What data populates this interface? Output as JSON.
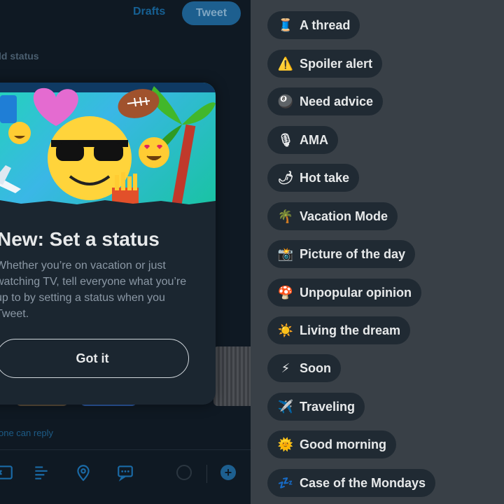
{
  "composer": {
    "drafts_label": "Drafts",
    "tweet_button_label": "Tweet",
    "add_status_label": "ld status",
    "reply_setting_label": "one can reply"
  },
  "toolbar": {
    "icons": [
      "gif-icon",
      "poll-icon",
      "location-icon",
      "chat-icon"
    ],
    "add_button_label": "+"
  },
  "popup": {
    "title": "New: Set a status",
    "body": "Whether you’re on vacation or just watching TV, tell everyone what you’re up to by setting a status when you Tweet.",
    "button_label": "Got it",
    "art_icons": [
      "sunglasses-emoji-icon",
      "heart-icon",
      "airplane-icon",
      "football-icon",
      "palm-tree-icon",
      "heart-eyes-emoji-icon",
      "fries-icon",
      "laughing-emoji-icon"
    ]
  },
  "status_options": [
    {
      "emoji": "🧵",
      "icon": "thread-spool-icon",
      "label": "A thread"
    },
    {
      "emoji": "⚠️",
      "icon": "warning-icon",
      "label": "Spoiler alert"
    },
    {
      "emoji": "🎱",
      "icon": "eight-ball-icon",
      "label": "Need advice"
    },
    {
      "emoji": "🎙",
      "icon": "microphone-icon",
      "label": "AMA"
    },
    {
      "emoji": "🌶",
      "icon": "chili-pepper-icon",
      "label": "Hot take"
    },
    {
      "emoji": "🌴",
      "icon": "palm-tree-icon",
      "label": "Vacation Mode"
    },
    {
      "emoji": "📸",
      "icon": "camera-flash-icon",
      "label": "Picture of the day"
    },
    {
      "emoji": "🍄",
      "icon": "mushroom-icon",
      "label": "Unpopular opinion"
    },
    {
      "emoji": "☀️",
      "icon": "sun-icon",
      "label": "Living the dream"
    },
    {
      "emoji": "⚡",
      "icon": "lightning-icon",
      "label": "Soon"
    },
    {
      "emoji": "✈️",
      "icon": "airplane-icon",
      "label": "Traveling"
    },
    {
      "emoji": "🌞",
      "icon": "sun-face-icon",
      "label": "Good morning"
    },
    {
      "emoji": "💤",
      "icon": "sleeping-zzz-icon",
      "label": "Case of the Mondays"
    }
  ],
  "colors": {
    "accent": "#1d9bf0",
    "left_background": "#0f1923",
    "right_background": "#394047",
    "chip_background": "#202a33",
    "text_primary": "#e7e9ea",
    "text_secondary": "#8b98a5"
  }
}
